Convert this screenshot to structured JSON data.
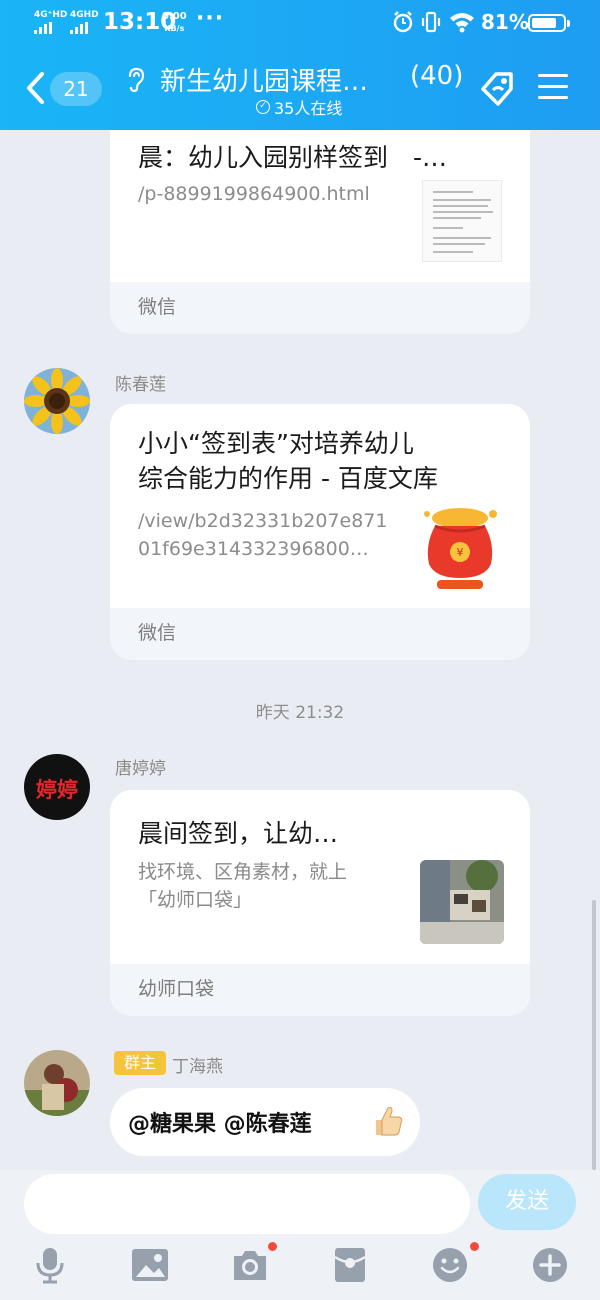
{
  "status": {
    "sim1": "4G⁺HD",
    "sim2": "4GHD",
    "time": "13:10",
    "speed_value": "0.00",
    "speed_unit": "KB/s",
    "more": "···",
    "battery": "81%",
    "battery_level": 0.81
  },
  "header": {
    "back_count": "21",
    "title": "新生幼儿园课程…",
    "member_count": "(40)",
    "online": "35人在线"
  },
  "messages": {
    "card1": {
      "title_line1": "晨：幼儿入园别样签到　-…",
      "url": "/p-8899199864900.html",
      "source": "微信"
    },
    "card2": {
      "sender": "陈春莲",
      "title_line1": "小小“签到表”对培养幼儿",
      "title_line2": "综合能力的作用 - 百度文库",
      "url_line1": "/view/b2d32331b207e871",
      "url_line2": "01f69e314332396800…",
      "source": "微信"
    },
    "time_separator": "昨天 21:32",
    "card3": {
      "sender": "唐婷婷",
      "avatar_text": "婷婷",
      "title": "晨间签到，让幼…",
      "desc_line1": "找环境、区角素材，就上",
      "desc_line2": "「幼师口袋」",
      "source": "幼师口袋"
    },
    "text_message": {
      "badge": "群主",
      "sender": "丁海燕",
      "text": "@糖果果 @陈春莲"
    }
  },
  "input": {
    "placeholder": "",
    "send_label": "发送"
  },
  "colors": {
    "header_start": "#1ab5f6",
    "header_end": "#1e9df2",
    "send_button": "#b9e6fb",
    "owner_badge": "#f7c33d",
    "notification_dot": "#f34c3c"
  },
  "toolbar": {
    "icons": [
      "microphone-icon",
      "image-icon",
      "camera-icon",
      "red-packet-icon",
      "emoji-icon",
      "plus-icon"
    ]
  }
}
